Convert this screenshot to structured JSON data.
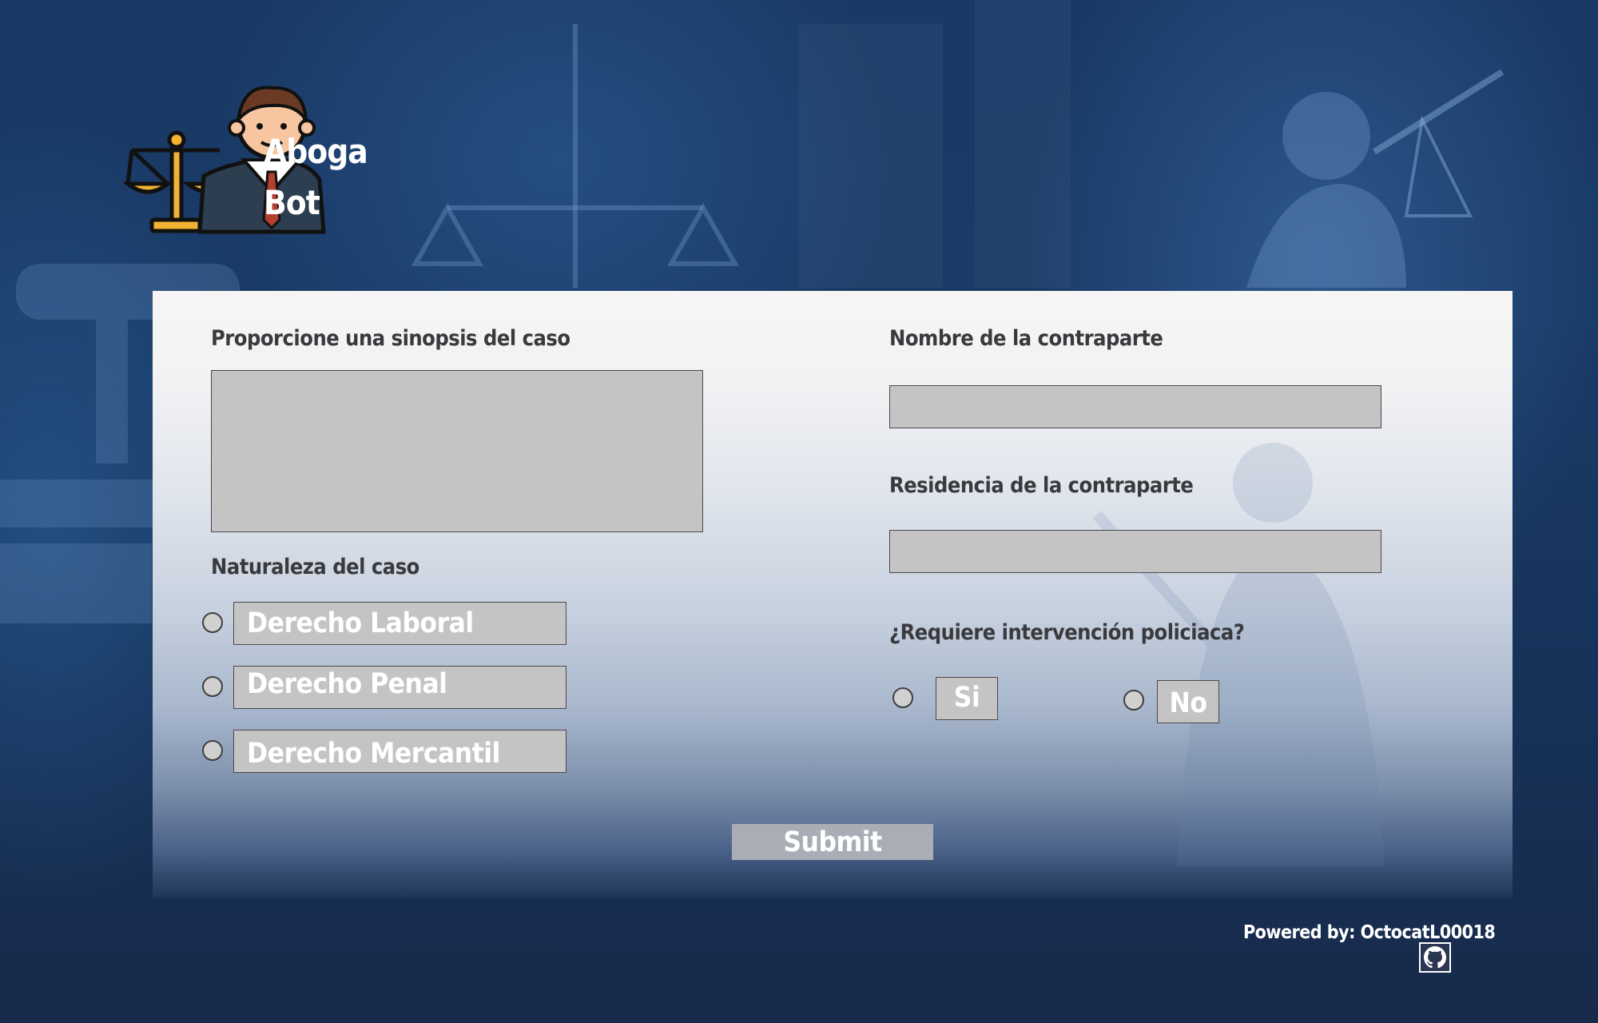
{
  "brand": {
    "line1": "Aboga",
    "line2": "Bot"
  },
  "form": {
    "synopsis_label": "Proporcione una sinopsis del caso",
    "synopsis_value": "",
    "nature_label": "Naturaleza del caso",
    "nature_options": [
      "Derecho Laboral",
      "Derecho Penal",
      "Derecho Mercantil"
    ],
    "counterpart_name_label": "Nombre de la contraparte",
    "counterpart_name_value": "",
    "counterpart_residence_label": "Residencia de la contraparte",
    "counterpart_residence_value": "",
    "police_label": "¿Requiere intervención policiaca?",
    "police_options": [
      "Si",
      "No"
    ],
    "submit_label": "Submit"
  },
  "footer": {
    "powered_by": "Powered by: OctocatL00018",
    "icon": "github-icon"
  },
  "colors": {
    "panel_top": "#f7f5f4",
    "field_bg": "#c4c4c4",
    "label_text": "#3a3a3e",
    "page_bg": "#172a4a",
    "submit_bg": "#a9adb5"
  }
}
